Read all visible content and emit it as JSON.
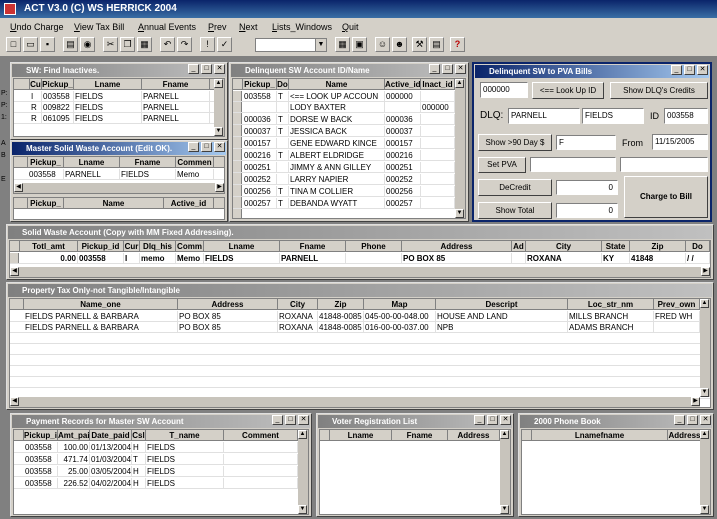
{
  "app": {
    "title": "ACT V3.0 (C) WS HERRICK 2004"
  },
  "menu": [
    "Undo Charge",
    "View Tax Bill",
    "Annual Events",
    "Prev",
    "Next",
    "Lists_Windows",
    "Quit"
  ],
  "toolbar": {
    "icons": [
      "new-icon",
      "open-icon",
      "save-icon",
      "print-icon",
      "preview-icon",
      "cut-icon",
      "copy-icon",
      "paste-icon",
      "undo-icon",
      "redo-icon",
      "edit-icon",
      "spell-icon",
      "calendar-icon",
      "form-icon",
      "people-icon",
      "people2-icon",
      "toolbox-icon",
      "report-icon",
      "help-icon"
    ],
    "help_glyph": "?"
  },
  "find_inactives": {
    "title": "SW: Find Inactives.",
    "columns": [
      "Cu",
      "Pickup_",
      "Lname",
      "Fname"
    ],
    "rows": [
      [
        "I",
        "003558",
        "FIELDS",
        "PARNELL"
      ],
      [
        "R",
        "009822",
        "FIELDS",
        "PARNELL"
      ],
      [
        "R",
        "061095",
        "FIELDS",
        "PARNELL"
      ]
    ],
    "side_marks": [
      "P:",
      "P:",
      "1:",
      "A",
      "B",
      "E"
    ]
  },
  "master_sw": {
    "title": "Master Solid Waste Account (Edit OK).",
    "columns": [
      "Pickup_",
      "Lname",
      "Fname",
      "Commen"
    ],
    "rows": [
      [
        "003558",
        "PARNELL",
        "FIELDS",
        "Memo"
      ]
    ],
    "sub_columns": [
      "Pickup_",
      "Name",
      "Active_id"
    ]
  },
  "delinquent_sw": {
    "title": "Delinquent SW Account ID/Name",
    "columns": [
      "Pickup_",
      "Do",
      "Name",
      "Active_id",
      "Inact_id"
    ],
    "rows": [
      [
        "003558",
        "T",
        "<== LOOK UP ACCOUN",
        "000000",
        ""
      ],
      [
        "",
        "",
        "LODY BAXTER",
        "",
        "000000"
      ],
      [
        "000036",
        "T",
        "DORSE W BACK",
        "000036",
        ""
      ],
      [
        "000037",
        "T",
        "JESSICA BACK",
        "000037",
        ""
      ],
      [
        "000157",
        "",
        "GENE EDWARD KINCE",
        "000157",
        ""
      ],
      [
        "000216",
        "T",
        "ALBERT ELDRIDGE",
        "000216",
        ""
      ],
      [
        "000251",
        "",
        "JIMMY & ANN GILLEY",
        "000251",
        ""
      ],
      [
        "000252",
        "",
        "LARRY NAPIER",
        "000252",
        ""
      ],
      [
        "000256",
        "T",
        "TINA M COLLIER",
        "000256",
        ""
      ],
      [
        "000257",
        "T",
        "DEBANDA WYATT",
        "000257",
        ""
      ]
    ]
  },
  "pva": {
    "title": "Delinquent SW to PVA Bills",
    "lookup_value": "000000",
    "lookup_button": "<== Look Up ID",
    "credits_button": "Show DLQ's Credits",
    "dlq_label": "DLQ:",
    "dlq_lname": "PARNELL",
    "dlq_fname": "FIELDS",
    "id_label": "ID",
    "id_value": "003558",
    "show90_button": "Show >90 Day $",
    "show90_value": "F",
    "from_label": "From",
    "from_value": "11/15/2005",
    "setpva_button": "Set PVA",
    "decredit_button": "DeCredit",
    "decredit_value": "0",
    "showtotal_button": "Show Total",
    "showtotal_value": "0",
    "charge_button": "Charge to Bill"
  },
  "sw_account": {
    "title": "Solid Waste  Account  (Copy with MM Fixed Addressing).",
    "columns": [
      "Totl_amt",
      "Pickup_id",
      "Cur",
      "Dlq_his",
      "Comm",
      "Lname",
      "Fname",
      "Phone",
      "Address",
      "Ad",
      "City",
      "State",
      "Zip",
      "Do"
    ],
    "row": [
      "0.00",
      "003558",
      "I",
      "memo",
      "Memo",
      "FIELDS",
      "PARNELL",
      "",
      "PO BOX 85",
      "",
      "ROXANA",
      "KY",
      "41848",
      "/ /"
    ]
  },
  "property_tax": {
    "title": "Property Tax Only-not Tangible/Intangible",
    "columns": [
      "Name_one",
      "Address",
      "City",
      "Zip",
      "Map",
      "Descript",
      "Loc_str_nm",
      "Prev_own"
    ],
    "rows": [
      [
        "FIELDS PARNELL & BARBARA",
        "PO BOX 85",
        "ROXANA",
        "41848-0085",
        "045-00-00-048.00",
        "HOUSE AND LAND",
        "MILLS BRANCH",
        "FRED WH"
      ],
      [
        "FIELDS PARNELL & BARBARA",
        "PO BOX 85",
        "ROXANA",
        "41848-0085",
        "016-00-00-037.00",
        "NPB",
        "ADAMS BRANCH",
        ""
      ]
    ]
  },
  "payments": {
    "title": "Payment Records for Master SW Account",
    "columns": [
      "Pickup_i",
      "Amt_pai",
      "Date_paid",
      "Csl",
      "T_name",
      "Comment"
    ],
    "rows": [
      [
        "003558",
        "100.00",
        "01/13/2004",
        "H",
        "FIELDS",
        ""
      ],
      [
        "003558",
        "471.74",
        "01/03/2004",
        "T",
        "FIELDS",
        ""
      ],
      [
        "003558",
        "25.00",
        "03/05/2004",
        "H",
        "FIELDS",
        ""
      ],
      [
        "003558",
        "226.52",
        "04/02/2004",
        "H",
        "FIELDS",
        ""
      ]
    ]
  },
  "voter": {
    "title": "Voter Registration List",
    "columns": [
      "Lname",
      "Fname",
      "Address"
    ]
  },
  "phone": {
    "title": "2000 Phone Book",
    "columns": [
      "Lnamefname",
      "Address"
    ]
  }
}
